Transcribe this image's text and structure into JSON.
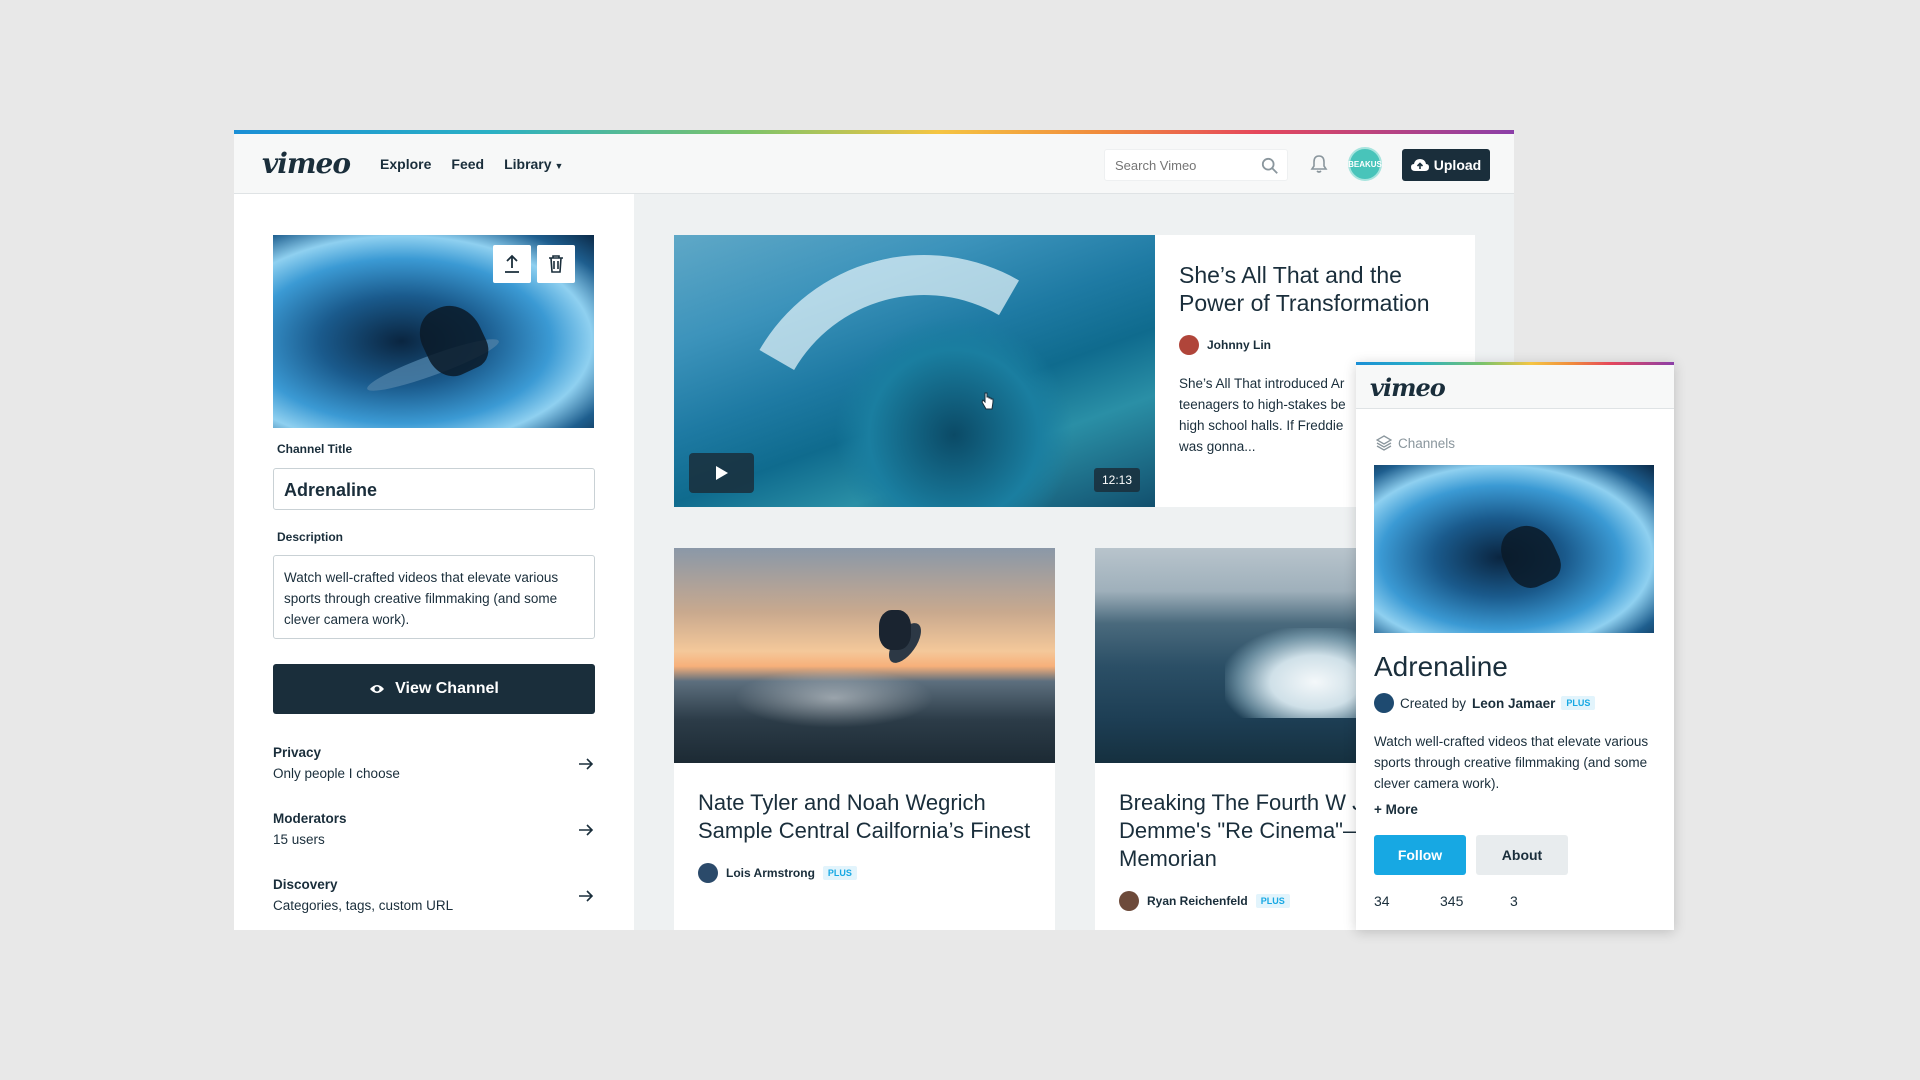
{
  "brand": {
    "logo": "vimeo"
  },
  "nav": {
    "links": [
      "Explore",
      "Feed",
      "Library"
    ],
    "search_placeholder": "Search Vimeo",
    "avatar_initials": "BEAKUS",
    "upload_label": "Upload"
  },
  "editor": {
    "channel_title_label": "Channel Title",
    "channel_title_value": "Adrenaline",
    "description_label": "Description",
    "description_value": "Watch well-crafted videos that elevate various sports through creative filmmaking (and some clever camera work).",
    "view_channel_label": "View Channel",
    "settings": [
      {
        "title": "Privacy",
        "sub": "Only people I choose"
      },
      {
        "title": "Moderators",
        "sub": "15 users"
      },
      {
        "title": "Discovery",
        "sub": "Categories, tags, custom URL"
      }
    ]
  },
  "featured": {
    "title": "She’s All That and the Power of Transformation",
    "author": "Johnny Lin",
    "duration": "12:13",
    "description": "She’s All That introduced Ar teenagers to high-stakes be high school halls. If Freddie was gonna..."
  },
  "cards": [
    {
      "title": "Nate Tyler and Noah Wegrich Sample Central Cailfornia’s Finest",
      "author": "Lois Armstrong",
      "badge": "PLUS"
    },
    {
      "title": "Breaking The Fourth W Jonathan Demme's \"Re Cinema\"—In Memorian",
      "author": "Ryan Reichenfeld",
      "badge": "PLUS"
    }
  ],
  "popup": {
    "logo": "vimeo",
    "section_label": "Channels",
    "title": "Adrenaline",
    "created_by_prefix": "Created by",
    "creator": "Leon Jamaer",
    "badge": "PLUS",
    "description": "Watch well-crafted videos that elevate various sports through creative filmmaking (and some clever camera work).",
    "more_label": "+ More",
    "follow_label": "Follow",
    "about_label": "About",
    "stats": [
      "34",
      "345",
      "3"
    ]
  },
  "colors": {
    "navy": "#1a2e3b",
    "accent_blue": "#17a8e3",
    "avatar_teal": "#48c4ba"
  }
}
